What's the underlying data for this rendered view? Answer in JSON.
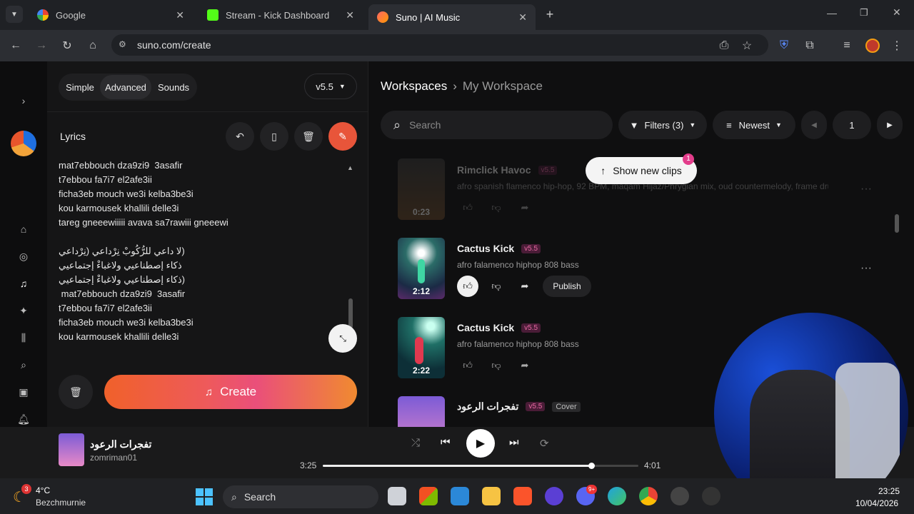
{
  "browser": {
    "tabs": [
      {
        "label": "Google",
        "active": false
      },
      {
        "label": "Stream - Kick Dashboard",
        "active": false
      },
      {
        "label": "Suno | AI Music",
        "active": true
      }
    ],
    "url": "suno.com/create"
  },
  "create": {
    "modes": [
      "Simple",
      "Advanced",
      "Sounds"
    ],
    "active_mode": "Advanced",
    "version": "v5.5",
    "lyrics_label": "Lyrics",
    "lyrics_lines": [
      "mat7ebbouch dza9zi9  3asafir",
      "t7ebbou fa7i7 el2afe3ii",
      "ficha3eb mouch we3i kelba3be3i",
      "kou karmousek khallili delle3i",
      "tareg gneeewiiiii avava sa7rawiii gneeewi",
      "",
      "(لا داعي للرُّكُوبْ نِرْداعي (نِرْداعي",
      "ذكاء إصطناعيي ولاغباءْ إجتماعيي",
      "(ذكاء إصطناعيي ولاغباءْ إجتماعيي",
      " mat7ebbouch dza9zi9  3asafir",
      "t7ebbou fa7i7 el2afe3ii",
      "ficha3eb mouch we3i kelba3be3i",
      "kou karmousek khallili delle3i"
    ],
    "create_label": "Create"
  },
  "workspace": {
    "root": "Workspaces",
    "current": "My Workspace",
    "search_placeholder": "Search",
    "filters_label": "Filters (3)",
    "sort_label": "Newest",
    "page": "1",
    "show_new_label": "Show new clips",
    "show_new_count": "1"
  },
  "clips": [
    {
      "title": "Rimclick Havoc",
      "version": "v5.5",
      "desc": "afro spanish flamenco hip-hop, 92 BPM, maqam Hijaz/Phrygian mix, oud countermelody, frame drums, c...",
      "duration": "0:23",
      "faded": true
    },
    {
      "title": "Cactus Kick",
      "version": "v5.5",
      "desc": "afro falamenco hiphop 808 bass",
      "duration": "2:12",
      "publish": "Publish"
    },
    {
      "title": "Cactus Kick",
      "version": "v5.5",
      "desc": "afro falamenco hiphop 808 bass",
      "duration": "2:22"
    },
    {
      "title": "تفجرات الرعود",
      "version": "v5.5",
      "cover": "Cover"
    }
  ],
  "player": {
    "title": "تفجرات الرعود",
    "artist": "zomriman01",
    "elapsed": "3:25",
    "total": "4:01",
    "progress": 0.85
  },
  "taskbar": {
    "weather_temp": "4°C",
    "weather_place": "Bezchmurnie",
    "weather_badge": "3",
    "search": "Search",
    "time": "23:25",
    "date": "10/04/2026",
    "discord_badge": "9+"
  }
}
